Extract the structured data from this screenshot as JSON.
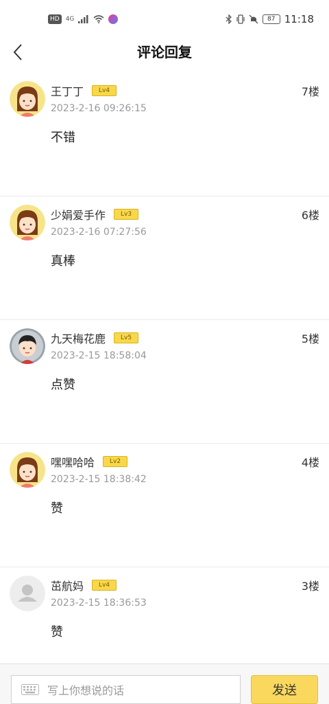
{
  "status_bar": {
    "network_badge": "HD",
    "network_type": "4G",
    "battery": "87",
    "time": "11:18"
  },
  "header": {
    "title": "评论回复"
  },
  "comments": [
    {
      "name": "王丁丁",
      "level": "Lv4",
      "floor": "7楼",
      "date": "2023-2-16 09:26:15",
      "content": "不错",
      "avatar": "girl"
    },
    {
      "name": "少娟爱手作",
      "level": "Lv3",
      "floor": "6楼",
      "date": "2023-2-16 07:27:56",
      "content": "真棒",
      "avatar": "girl"
    },
    {
      "name": "九天梅花鹿",
      "level": "Lv5",
      "floor": "5楼",
      "date": "2023-2-15 18:58:04",
      "content": "点赞",
      "avatar": "boy"
    },
    {
      "name": "嘿嘿哈哈",
      "level": "Lv2",
      "floor": "4楼",
      "date": "2023-2-15 18:38:42",
      "content": "赞",
      "avatar": "girl"
    },
    {
      "name": "茁航妈",
      "level": "Lv4",
      "floor": "3楼",
      "date": "2023-2-15 18:36:53",
      "content": "赞",
      "avatar": "default"
    }
  ],
  "composer": {
    "placeholder": "写上你想说的话",
    "send_label": "发送"
  }
}
